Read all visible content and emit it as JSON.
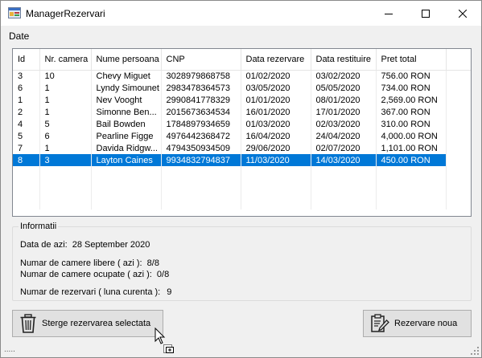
{
  "window": {
    "title": "ManagerRezervari"
  },
  "menu": {
    "items": [
      "Date"
    ]
  },
  "grid": {
    "columns": [
      "Id",
      "Nr. camera",
      "Nume persoana",
      "CNP",
      "Data rezervare",
      "Data restituire",
      "Pret total"
    ],
    "rows": [
      [
        "3",
        "10",
        "Chevy Miguet",
        "3028979868758",
        "01/02/2020",
        "03/02/2020",
        "756.00 RON"
      ],
      [
        "6",
        "1",
        "Lyndy Simounet",
        "2983478364573",
        "03/05/2020",
        "05/05/2020",
        "734.00 RON"
      ],
      [
        "1",
        "1",
        "Nev Vooght",
        "2990841778329",
        "01/01/2020",
        "08/01/2020",
        "2,569.00 RON"
      ],
      [
        "2",
        "1",
        "Simonne Ben...",
        "2015673634534",
        "16/01/2020",
        "17/01/2020",
        "367.00 RON"
      ],
      [
        "4",
        "5",
        "Bail Bowden",
        "1784897934659",
        "01/03/2020",
        "02/03/2020",
        "310.00 RON"
      ],
      [
        "5",
        "6",
        "Pearline Figge",
        "4976442368472",
        "16/04/2020",
        "24/04/2020",
        "4,000.00 RON"
      ],
      [
        "7",
        "1",
        "Davida Ridgw...",
        "4794350934509",
        "29/06/2020",
        "02/07/2020",
        "1,101.00 RON"
      ],
      [
        "8",
        "3",
        "Layton Caines",
        "9934832794837",
        "11/03/2020",
        "14/03/2020",
        "450.00 RON"
      ]
    ],
    "selected_row_index": 7,
    "selection_color": "#0078d7"
  },
  "info": {
    "title": "Informatii",
    "date_label": "Data de azi:",
    "date_value": "28 September 2020",
    "free_rooms_label": "Numar de camere libere ( azi ):",
    "free_rooms_value": "8/8",
    "occupied_rooms_label": "Numar de camere ocupate ( azi ):",
    "occupied_rooms_value": "0/8",
    "reservations_label": "Numar de rezervari ( luna curenta ):",
    "reservations_value": "9"
  },
  "buttons": {
    "delete_label": "Sterge rezervarea selectata",
    "new_label": "Rezervare noua"
  },
  "icons": {
    "delete": "trash-icon",
    "new": "clipboard-edit-icon",
    "minimize": "minimize-icon",
    "maximize": "maximize-icon",
    "close": "close-icon"
  }
}
